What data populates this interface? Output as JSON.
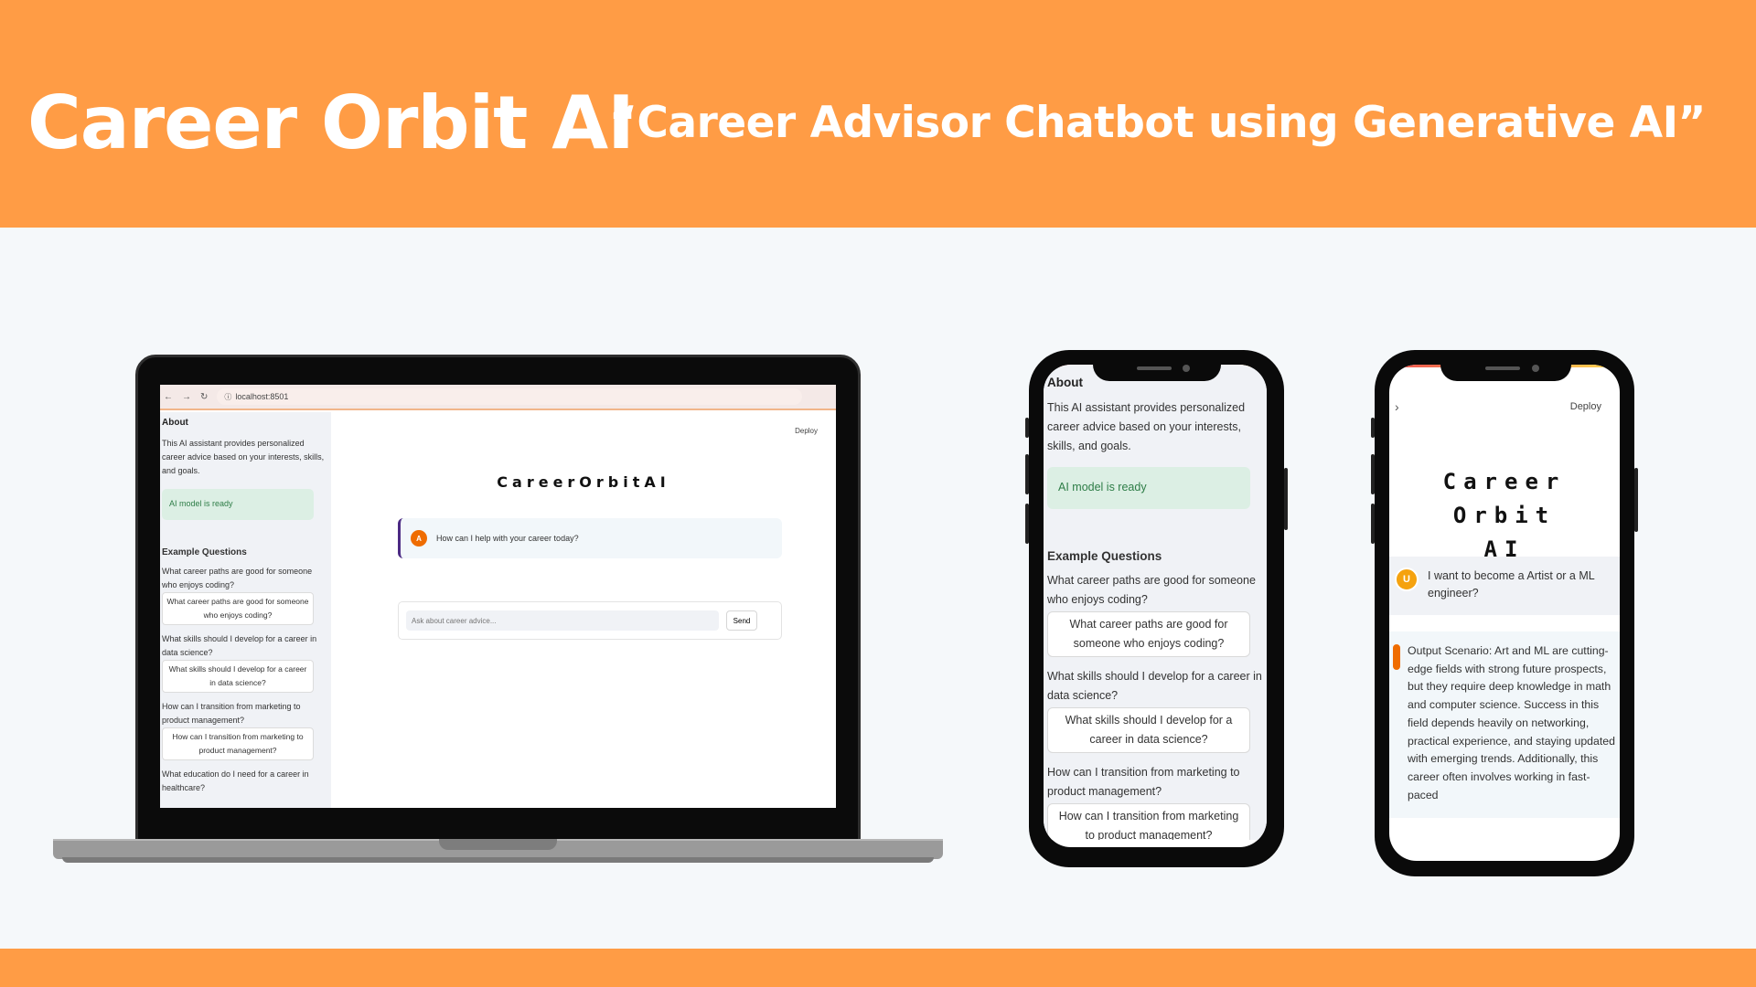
{
  "banner": {
    "title": "Career Orbit AI",
    "subtitle": "“Career Advisor Chatbot using Generative AI”"
  },
  "colors": {
    "brand_orange": "#ff9c45",
    "avatar_orange": "#ef6c00",
    "ready_green": "#2e7d47"
  },
  "browser": {
    "url": "localhost:8501"
  },
  "app": {
    "title": "CareerOrbitAI",
    "deploy_label": "Deploy",
    "about_heading": "About",
    "about_text": "This AI assistant provides personalized career advice based on your interests, skills, and goals.",
    "status": "AI model is ready",
    "examples_heading": "Example Questions",
    "questions": [
      "What career paths are good for someone who enjoys coding?",
      "What skills should I develop for a career in data science?",
      "How can I transition from marketing to product management?",
      "What education do I need for a career in healthcare?"
    ],
    "greeting": "How can I help with your career today?",
    "assistant_avatar": "A",
    "user_avatar": "U",
    "input_placeholder": "Ask about career advice...",
    "send_label": "Send"
  },
  "phone2": {
    "title_line1": "Career Orbit",
    "title_line2": "AI",
    "user_message": "I want to become a Artist or a ML engineer?",
    "assistant_message": "Output Scenario: Art and ML are cutting-edge fields with strong future prospects, but they require deep knowledge in math and computer science. Success in this field depends heavily on networking, practical experience, and staying updated with emerging trends. Additionally, this career often involves working in fast-paced"
  },
  "icons": [
    "back-arrow-icon",
    "forward-arrow-icon",
    "reload-icon",
    "site-info-icon",
    "chevron-right-icon"
  ]
}
